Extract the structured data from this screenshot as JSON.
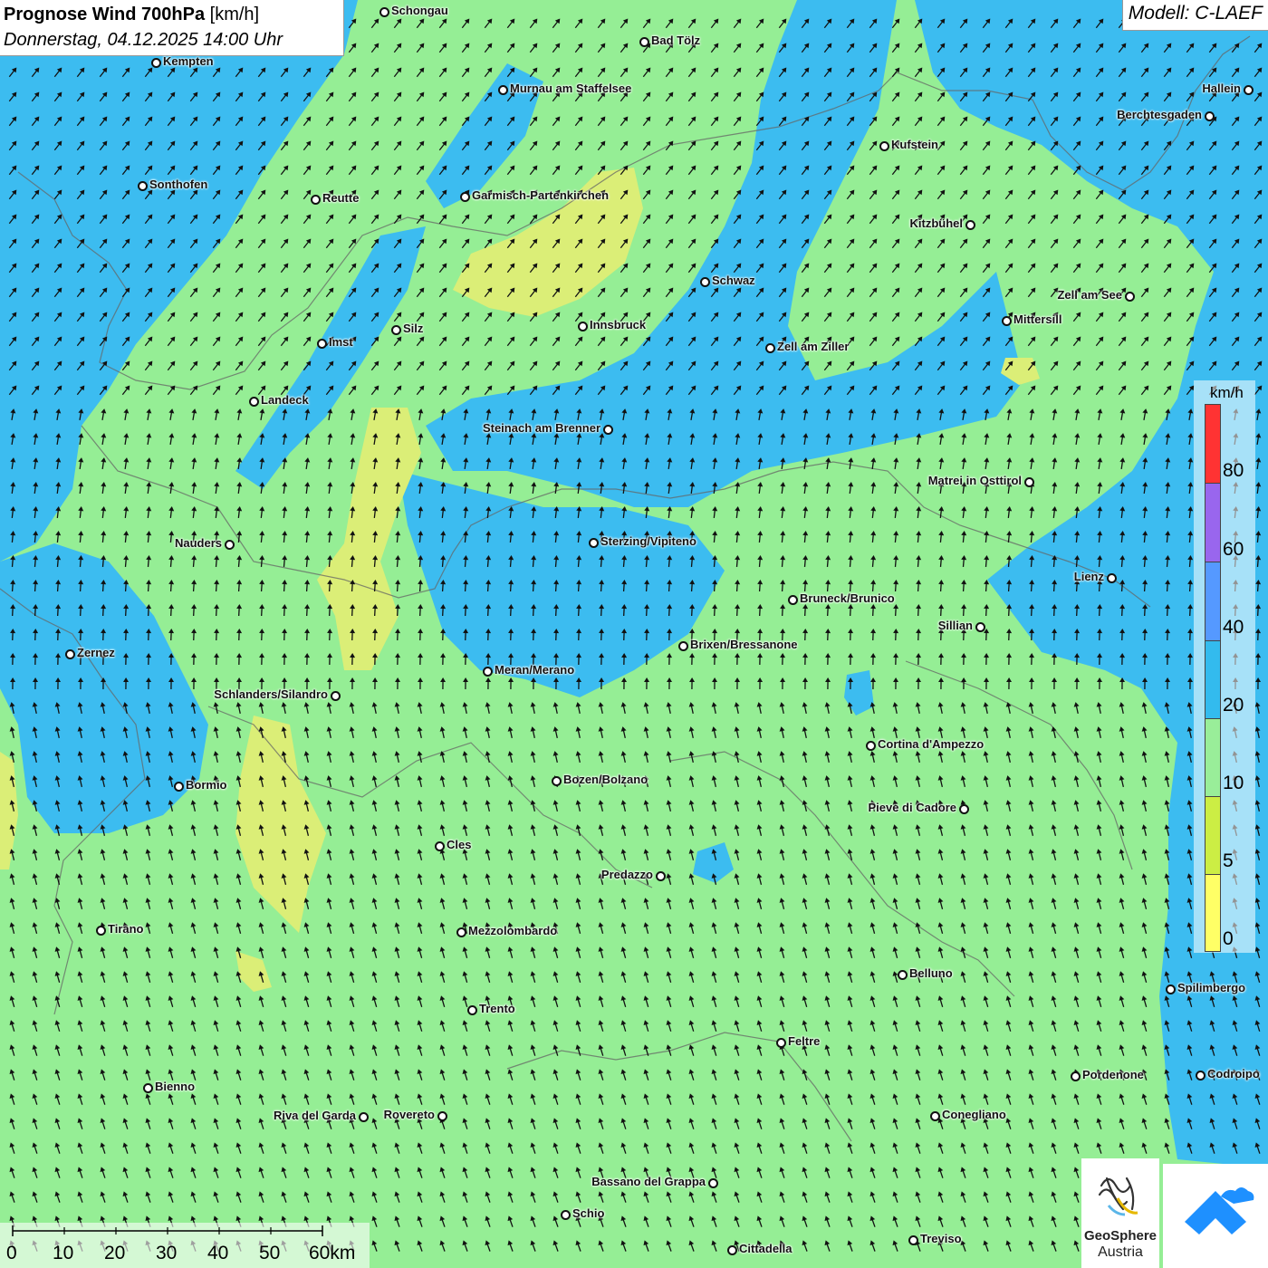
{
  "header": {
    "title_bold": "Prognose Wind 700hPa",
    "title_unit": " [km/h]",
    "datetime": "Donnerstag, 04.12.2025 14:00 Uhr",
    "model": "Modell: C-LAEF"
  },
  "legend": {
    "unit": "km/h",
    "ticks": [
      "80",
      "60",
      "40",
      "20",
      "10",
      "5",
      "0"
    ],
    "colors": [
      "#ff3333",
      "#9966ee",
      "#5599ff",
      "#33bbee",
      "#99ee99",
      "#ccee44",
      "#ffff66"
    ]
  },
  "scale": {
    "labels": [
      "0",
      "10",
      "20",
      "30",
      "40",
      "50",
      "60km"
    ]
  },
  "logos": {
    "geosphere_line1": "GeoSphere",
    "geosphere_line2": "Austria"
  },
  "map_colors": {
    "calm_green": "#95ee95",
    "moderate_blue": "#3cbcf0",
    "light_yellow": "#dbee77"
  },
  "cities": [
    {
      "name": "Schongau"
    },
    {
      "name": "Bad Tölz"
    },
    {
      "name": "Kempten"
    },
    {
      "name": "Murnau am Staffelsee"
    },
    {
      "name": "Hallein"
    },
    {
      "name": "Berchtesgaden"
    },
    {
      "name": "Kufstein"
    },
    {
      "name": "Sonthofen"
    },
    {
      "name": "Reutte"
    },
    {
      "name": "Garmisch-Partenkirchen"
    },
    {
      "name": "Kitzbühel"
    },
    {
      "name": "Schwaz"
    },
    {
      "name": "Zell am See"
    },
    {
      "name": "Mittersill"
    },
    {
      "name": "Innsbruck"
    },
    {
      "name": "Silz"
    },
    {
      "name": "Imst"
    },
    {
      "name": "Zell am Ziller"
    },
    {
      "name": "Landeck"
    },
    {
      "name": "Steinach am Brenner"
    },
    {
      "name": "Matrei in Osttirol"
    },
    {
      "name": "Nauders"
    },
    {
      "name": "Sterzing/Vipiteno"
    },
    {
      "name": "Lienz"
    },
    {
      "name": "Bruneck/Brunico"
    },
    {
      "name": "Sillian"
    },
    {
      "name": "Brixen/Bressanone"
    },
    {
      "name": "Zernez"
    },
    {
      "name": "Meran/Merano"
    },
    {
      "name": "Schlanders/Silandro"
    },
    {
      "name": "Cortina d'Ampezzo"
    },
    {
      "name": "Bozen/Bolzano"
    },
    {
      "name": "Bormio"
    },
    {
      "name": "Pieve di Cadore"
    },
    {
      "name": "Cles"
    },
    {
      "name": "Predazzo"
    },
    {
      "name": "Tirano"
    },
    {
      "name": "Mezzolombardo"
    },
    {
      "name": "Belluno"
    },
    {
      "name": "Spilimbergo"
    },
    {
      "name": "Trento"
    },
    {
      "name": "Feltre"
    },
    {
      "name": "Pordenone"
    },
    {
      "name": "Codroipo"
    },
    {
      "name": "Bienno"
    },
    {
      "name": "Riva del Garda"
    },
    {
      "name": "Rovereto"
    },
    {
      "name": "Conegliano"
    },
    {
      "name": "Bassano del Grappa"
    },
    {
      "name": "Schio"
    },
    {
      "name": "Treviso"
    },
    {
      "name": "Cittadella"
    }
  ]
}
